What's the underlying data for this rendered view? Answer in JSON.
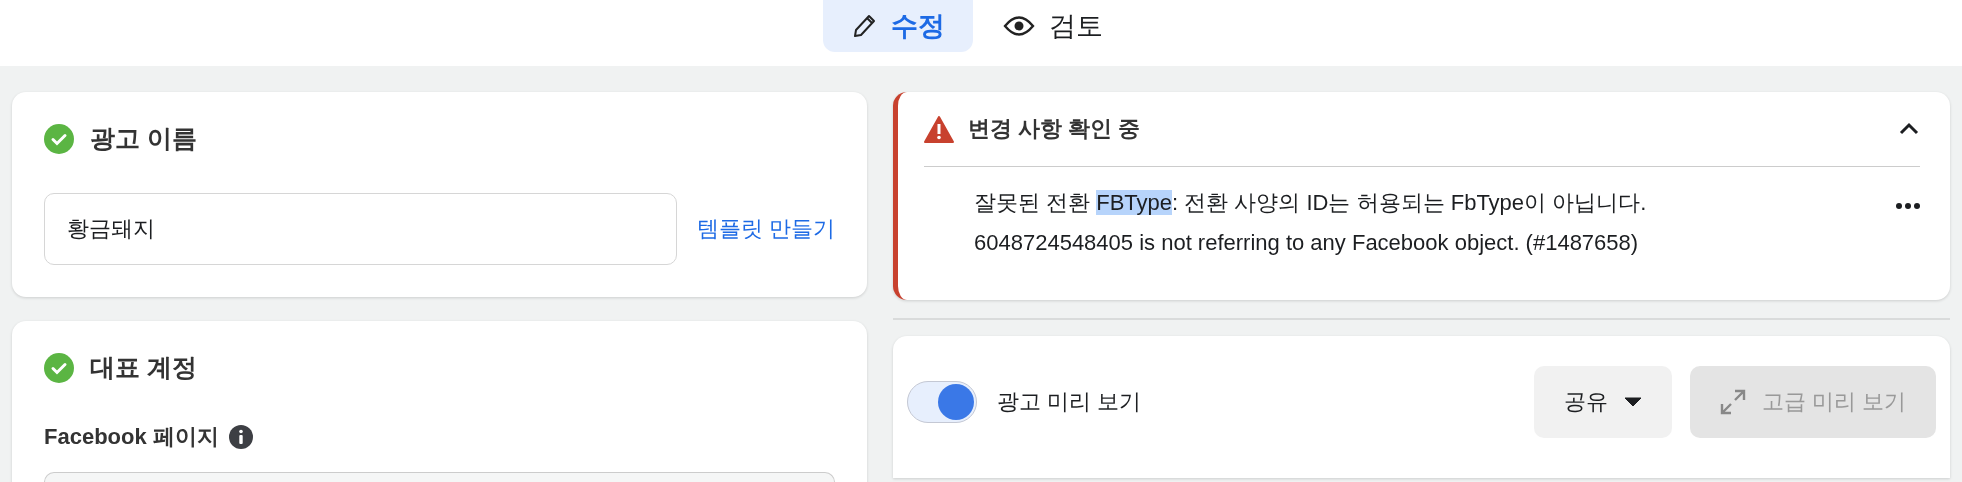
{
  "tabs": [
    {
      "label": "수정",
      "kind": "edit",
      "selected": true
    },
    {
      "label": "검토",
      "kind": "review",
      "selected": false
    }
  ],
  "ad_name_card": {
    "title": "광고 이름",
    "complete": true,
    "field_value": "황금돼지",
    "link": "템플릿 만들기"
  },
  "identity_card": {
    "title": "대표 계정",
    "complete": true,
    "field_label": "Facebook 페이지"
  },
  "alert": {
    "title": "변경 사항 확인 중",
    "expanded": true,
    "parts": [
      {
        "text": "잘못된 전환 ",
        "highlighted": false
      },
      {
        "text": "FBType",
        "highlighted": true
      },
      {
        "text": ": 전환 사양의 ID는 허용되는 FbType이 아닙니다.",
        "highlighted": false
      }
    ],
    "second_line": "6048724548405 is not referring to any Facebook object. (#1487658)"
  },
  "preview": {
    "toggle_label": "광고 미리 보기",
    "toggle_on": true,
    "share_button": "공유",
    "advanced_button": "고급 미리 보기",
    "advanced_disabled": true
  }
}
